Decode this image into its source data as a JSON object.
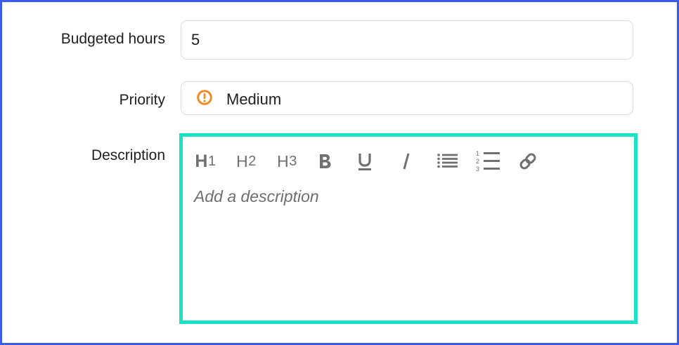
{
  "fields": {
    "budgeted_hours": {
      "label": "Budgeted hours",
      "value": "5"
    },
    "priority": {
      "label": "Priority",
      "value": "Medium",
      "icon": "alert-circle-icon",
      "icon_color": "#f08a24"
    },
    "description": {
      "label": "Description",
      "placeholder": "Add a description"
    }
  },
  "toolbar": {
    "h1": {
      "main": "H",
      "sub": "1",
      "icon": "heading-1-icon"
    },
    "h2": {
      "main": "H",
      "sub": "2",
      "icon": "heading-2-icon"
    },
    "h3": {
      "main": "H",
      "sub": "3",
      "icon": "heading-3-icon"
    },
    "bold": "bold-icon",
    "underline": "underline-icon",
    "italic": "italic-icon",
    "bullet_list": "bulleted-list-icon",
    "numbered_list": "numbered-list-icon",
    "link": "link-icon"
  },
  "colors": {
    "frame_border": "#3b5bf0",
    "editor_focus_border": "#19e3c4",
    "field_border": "#d9dce1"
  }
}
